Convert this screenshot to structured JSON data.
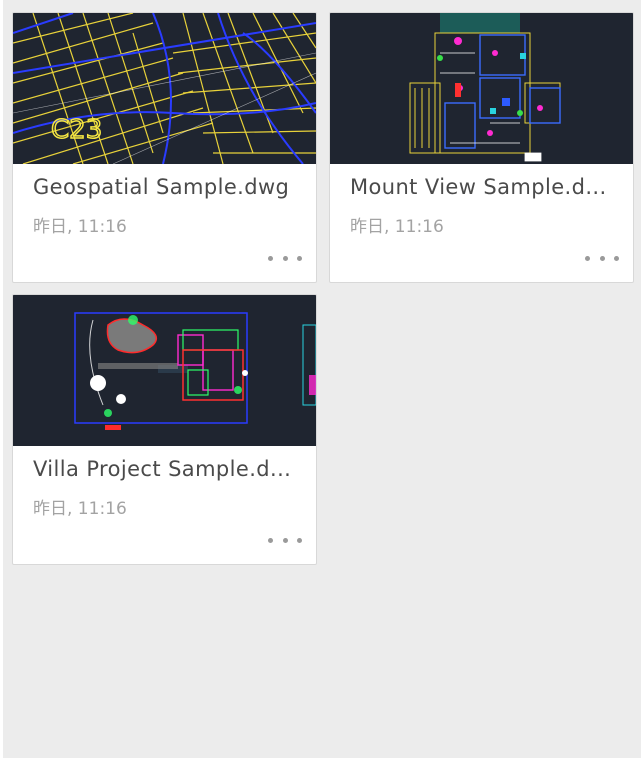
{
  "files": [
    {
      "name": "Geospatial Sample.dwg",
      "date": "昨日, 11:16",
      "thumb_label": "C23"
    },
    {
      "name": "Mount View Sample.d...",
      "date": "昨日, 11:16"
    },
    {
      "name": "Villa Project Sample.d...",
      "date": "昨日, 11:16"
    }
  ],
  "colors": {
    "background": "#ececec",
    "card": "#ffffff",
    "thumb_bg": "#1f2530",
    "title_text": "#4a4a4a",
    "date_text": "#a3a3a3",
    "more_dots": "#9a9a9a"
  },
  "icons": {
    "more": "more-horizontal-icon"
  }
}
